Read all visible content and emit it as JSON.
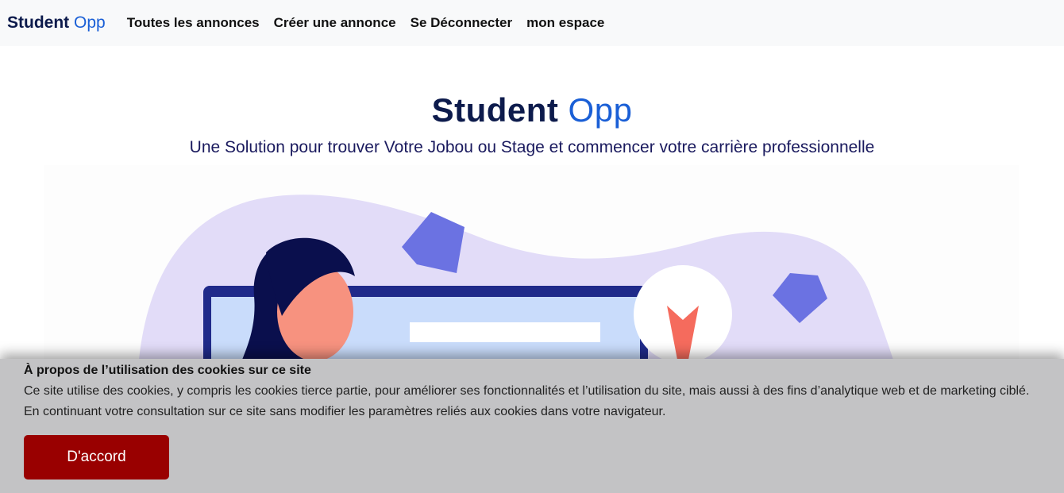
{
  "navbar": {
    "brand_main": "Student",
    "brand_accent": "Opp",
    "links": [
      {
        "label": "Toutes les annonces"
      },
      {
        "label": "Créer une annonce"
      },
      {
        "label": "Se Déconnecter"
      },
      {
        "label": "mon espace"
      }
    ]
  },
  "hero": {
    "title_main": "Student",
    "title_accent": "Opp",
    "subtitle": "Une Solution pour trouver Votre Jobou ou Stage et commencer votre carrière professionnelle"
  },
  "cookie": {
    "title": "À propos de l’utilisation des cookies sur ce site",
    "text": "Ce site utilise des cookies, y compris les cookies tierce partie, pour améliorer ses fonctionnalités et l’utilisation du site, mais aussi à des fins d’analytique web et de marketing ciblé. En continuant votre consultation sur ce site sans modifier les paramètres reliés aux cookies dans votre navigateur.",
    "accept_label": "D'accord"
  },
  "colors": {
    "brand_dark": "#0d1b4c",
    "brand_accent": "#1a5fd6",
    "accept_button": "#990000",
    "cookie_background": "#c3c3c5",
    "navbar_background": "#f8f9fa"
  }
}
